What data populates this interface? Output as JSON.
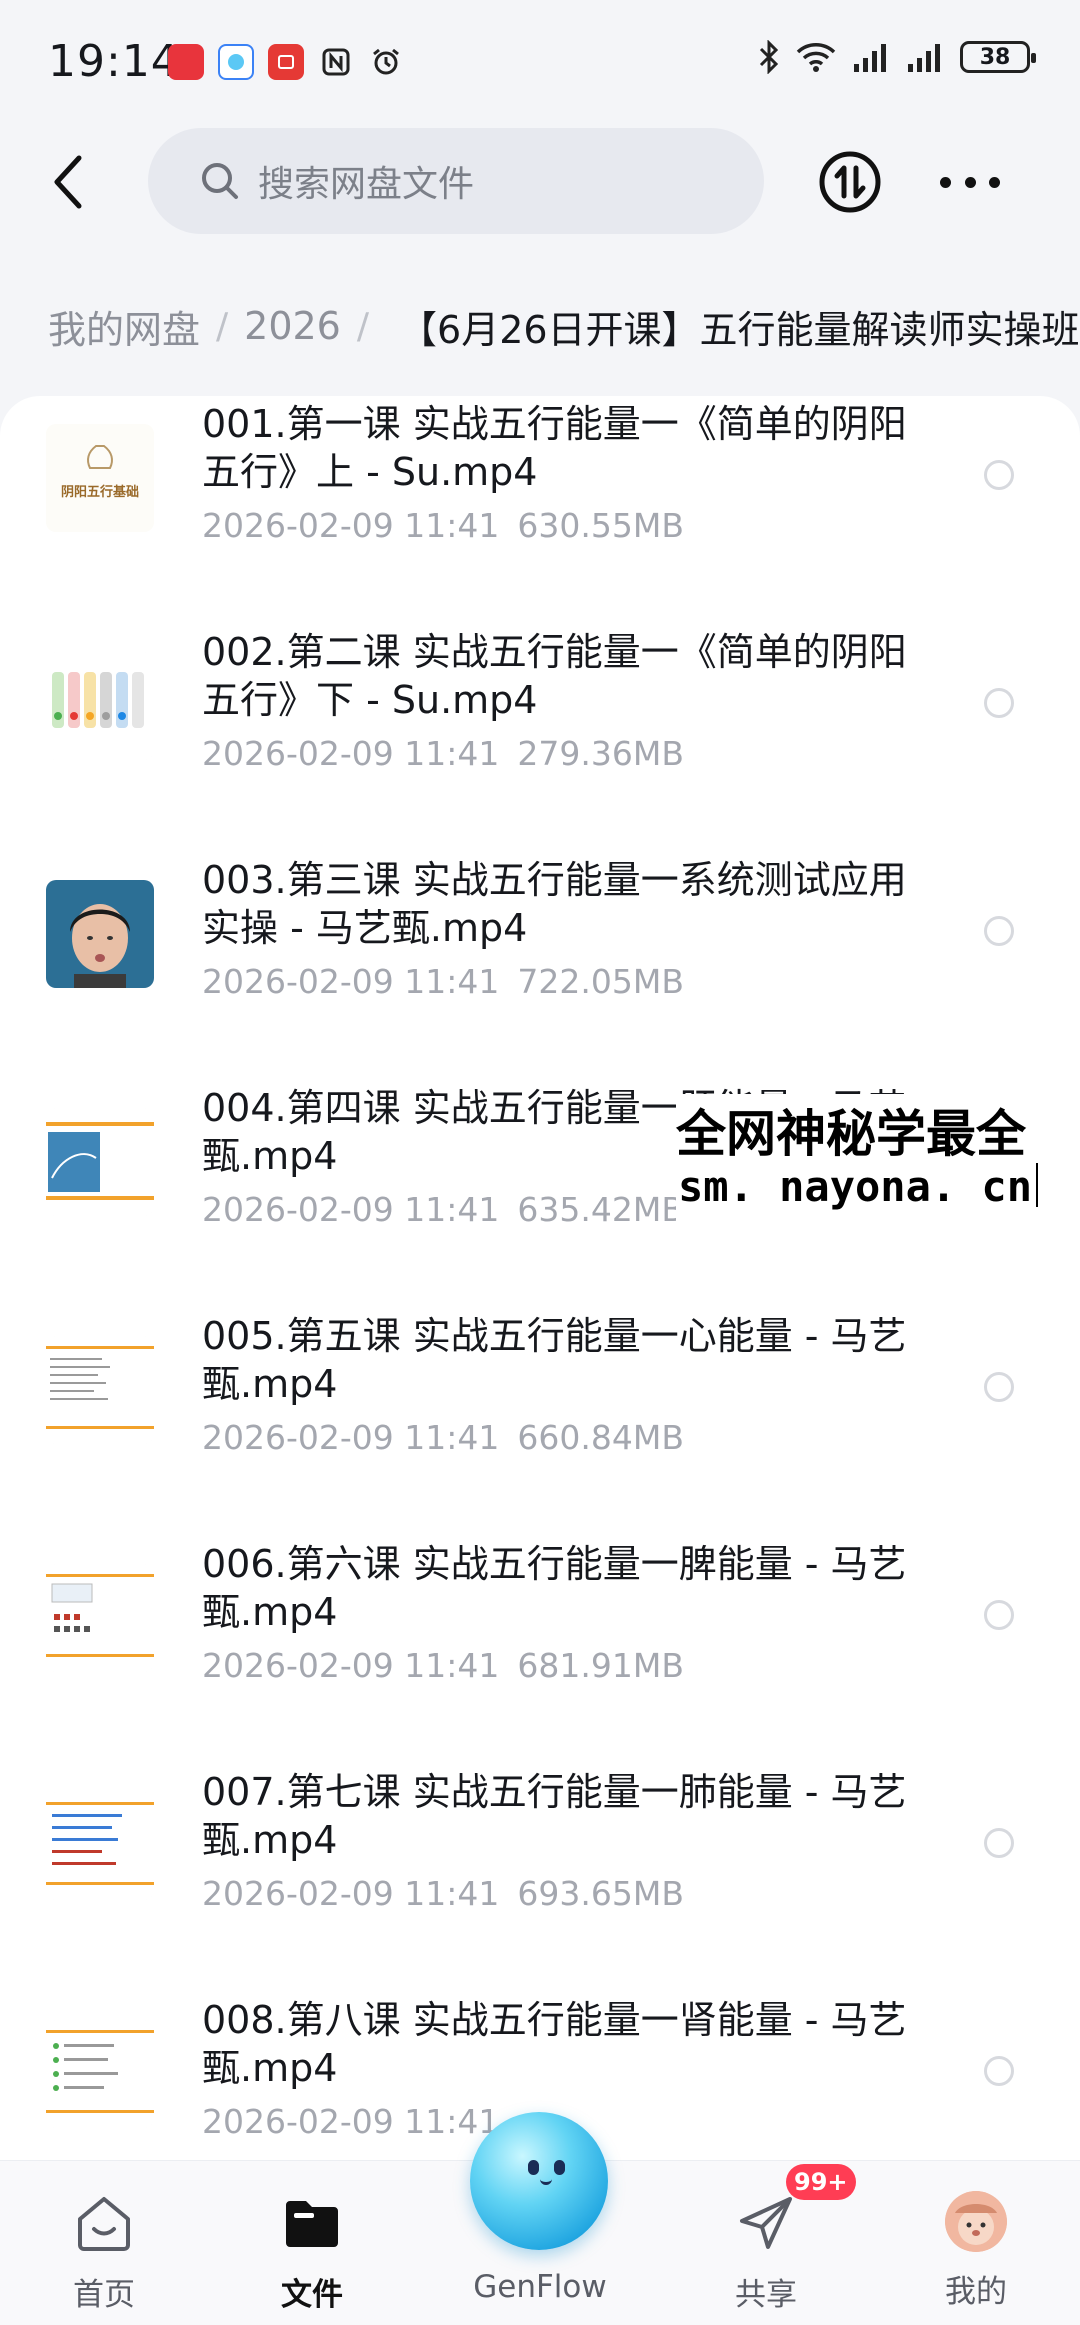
{
  "status_bar": {
    "time": "19:14",
    "apps": [
      {
        "name": "huawei-store",
        "color": "#e8343c",
        "label": "HUAWEI"
      },
      {
        "name": "genflow",
        "color": "#3b82f6",
        "label": "GenFlow"
      },
      {
        "name": "red-app",
        "color": "#e53935",
        "label": ""
      }
    ],
    "battery": "38"
  },
  "header": {
    "search_placeholder": "搜索网盘文件"
  },
  "breadcrumb": {
    "root": "我的网盘",
    "year": "2026",
    "current": "【6月26日开课】五行能量解读师实操班"
  },
  "files": [
    {
      "title": "001.第一课 实战五行能量一《简单的阴阳五行》上 - Su.mp4",
      "date": "2026-02-09",
      "time": "11:41",
      "size": "630.55MB",
      "thumb_caption": "阴阳五行基础"
    },
    {
      "title": "002.第二课 实战五行能量一《简单的阴阳五行》下 - Su.mp4",
      "date": "2026-02-09",
      "time": "11:41",
      "size": "279.36MB",
      "thumb_caption": ""
    },
    {
      "title": "003.第三课 实战五行能量一系统测试应用实操 - 马艺甄.mp4",
      "date": "2026-02-09",
      "time": "11:41",
      "size": "722.05MB",
      "thumb_caption": ""
    },
    {
      "title": "004.第四课 实战五行能量一肝能量 - 马艺甄.mp4",
      "date": "2026-02-09",
      "time": "11:41",
      "size": "635.42MB",
      "thumb_caption": ""
    },
    {
      "title": "005.第五课 实战五行能量一心能量 - 马艺甄.mp4",
      "date": "2026-02-09",
      "time": "11:41",
      "size": "660.84MB",
      "thumb_caption": ""
    },
    {
      "title": "006.第六课 实战五行能量一脾能量 - 马艺甄.mp4",
      "date": "2026-02-09",
      "time": "11:41",
      "size": "681.91MB",
      "thumb_caption": ""
    },
    {
      "title": "007.第七课 实战五行能量一肺能量 - 马艺甄.mp4",
      "date": "2026-02-09",
      "time": "11:41",
      "size": "693.65MB",
      "thumb_caption": ""
    },
    {
      "title": "008.第八课 实战五行能量一肾能量 - 马艺甄.mp4",
      "date": "2026-02-09",
      "time": "11:41",
      "size": "",
      "thumb_caption": ""
    }
  ],
  "watermark": {
    "line1": "全网神秘学最全",
    "line2": "sm. nayona. cn"
  },
  "bottom_nav": {
    "home": "首页",
    "files": "文件",
    "genflow": "GenFlow",
    "share": "共享",
    "share_badge": "99+",
    "me": "我的"
  },
  "colors": {
    "accent_blue": "#1ea4e0",
    "badge_red": "#ff3d54",
    "muted_text": "#a4a7af"
  }
}
